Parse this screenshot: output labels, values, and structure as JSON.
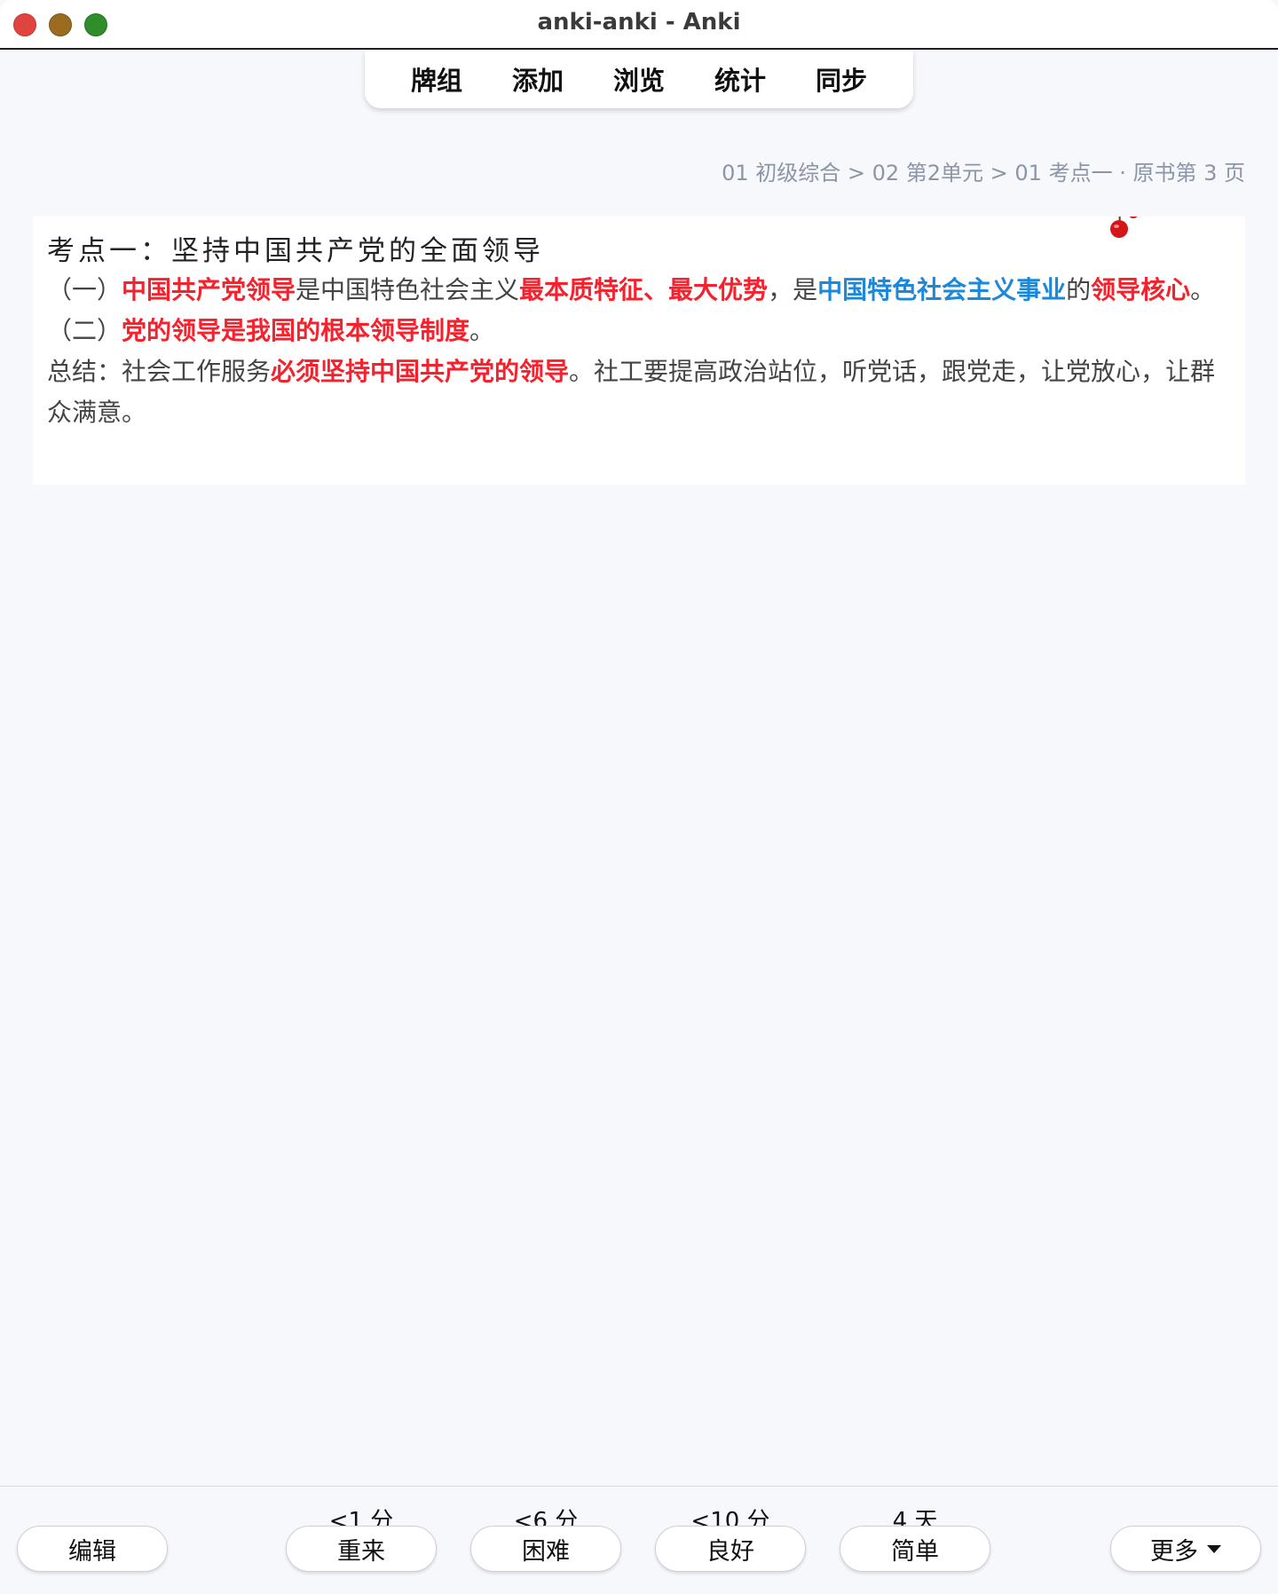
{
  "window": {
    "title": "anki-anki - Anki"
  },
  "toolbar": {
    "tabs": [
      {
        "label": "牌组"
      },
      {
        "label": "添加"
      },
      {
        "label": "浏览"
      },
      {
        "label": "统计"
      },
      {
        "label": "同步"
      }
    ]
  },
  "breadcrumb": "01 初级综合 > 02 第2单元 > 01 考点一 · 原书第 3 页",
  "card": {
    "heading": "考点一：坚持中国共产党的全面领导",
    "p1": {
      "a": "（一）",
      "b": "中国共产党领导",
      "c": "是中国特色社会主义",
      "d": "最本质特征、最大优势",
      "e": "，是",
      "f": "中国特色社会主义事业",
      "g": "的",
      "h": "领导核心",
      "i": "。"
    },
    "p2": {
      "a": "（二）",
      "b": "党的领导是我国的根本领导制度",
      "c": "。"
    },
    "p3": {
      "a": "总结：社会工作服务",
      "b": "必须坚持中国共产党的领导",
      "c": "。社工要提高政治站位，听党话，跟党走，让党放心，让群众满意。"
    },
    "decor_icon": "red-cherry-icon"
  },
  "bottom": {
    "edit_label": "编辑",
    "more_label": "更多",
    "answers": [
      {
        "interval": "<1 分",
        "label": "重来"
      },
      {
        "interval": "<6 分",
        "label": "困难"
      },
      {
        "interval": "<10 分",
        "label": "良好"
      },
      {
        "interval": "4 天",
        "label": "简单"
      }
    ]
  }
}
